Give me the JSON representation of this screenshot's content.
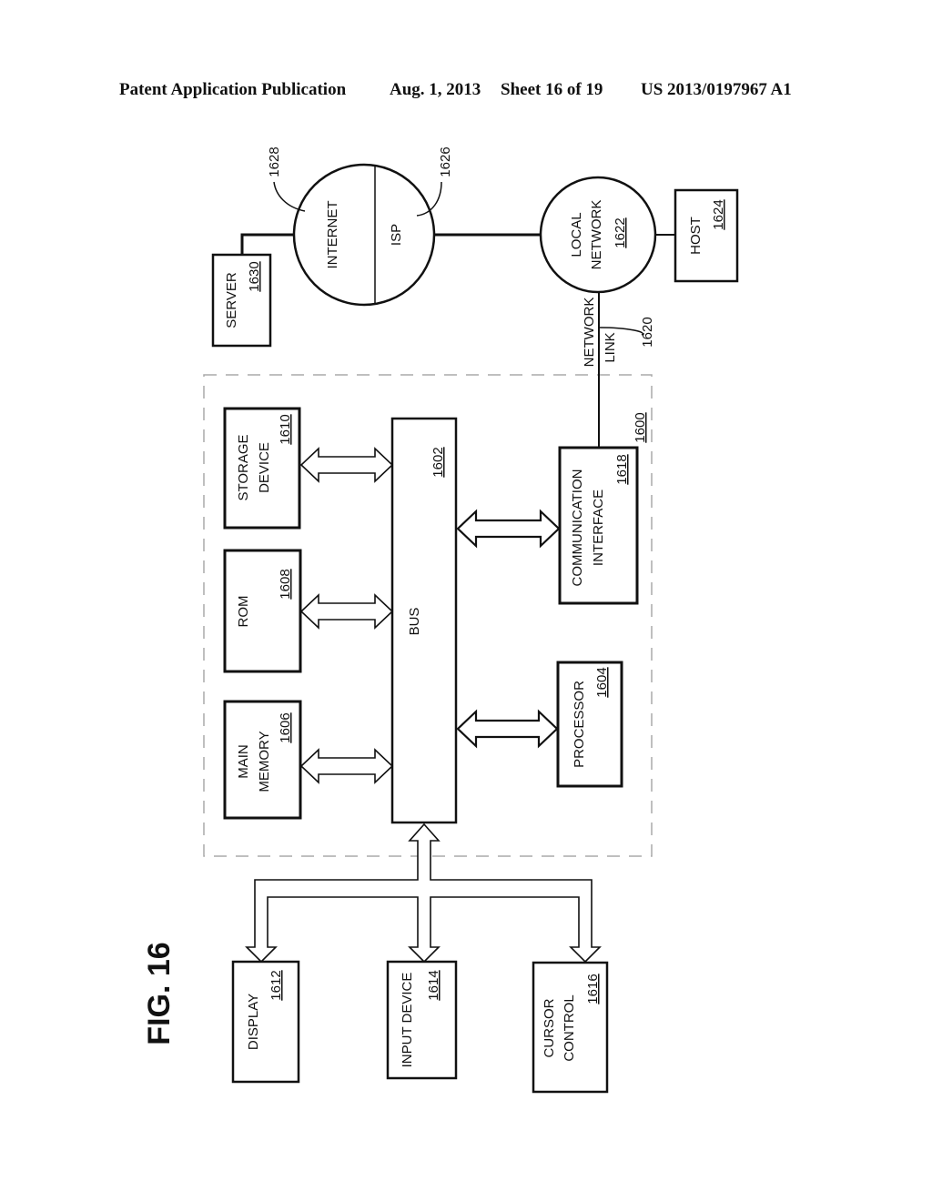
{
  "header": {
    "publication": "Patent Application Publication",
    "date": "Aug. 1, 2013",
    "sheet": "Sheet 16 of 19",
    "number": "US 2013/0197967 A1"
  },
  "figure": {
    "title": "FIG. 16",
    "system_ref": "1600"
  },
  "nodes": {
    "main_memory": {
      "line1": "MAIN",
      "line2": "MEMORY",
      "ref": "1606"
    },
    "rom": {
      "line1": "ROM",
      "ref": "1608"
    },
    "storage": {
      "line1": "STORAGE",
      "line2": "DEVICE",
      "ref": "1610"
    },
    "bus": {
      "line1": "BUS",
      "ref": "1602"
    },
    "processor": {
      "line1": "PROCESSOR",
      "ref": "1604"
    },
    "comm_interface": {
      "line1": "COMMUNICATION",
      "line2": "INTERFACE",
      "ref": "1618"
    },
    "display": {
      "line1": "DISPLAY",
      "ref": "1612"
    },
    "input_device": {
      "line1": "INPUT DEVICE",
      "ref": "1614"
    },
    "cursor_control": {
      "line1": "CURSOR",
      "line2": "CONTROL",
      "ref": "1616"
    },
    "server": {
      "line1": "SERVER",
      "ref": "1630"
    },
    "internet": {
      "line1": "INTERNET",
      "ref": "1628"
    },
    "isp": {
      "line1": "ISP",
      "ref": "1626"
    },
    "local_network": {
      "line1": "LOCAL",
      "line2": "NETWORK",
      "ref": "1622"
    },
    "host": {
      "line1": "HOST",
      "ref": "1624"
    },
    "network_link": {
      "line1": "NETWORK",
      "line2": "LINK",
      "ref": "1620"
    }
  }
}
